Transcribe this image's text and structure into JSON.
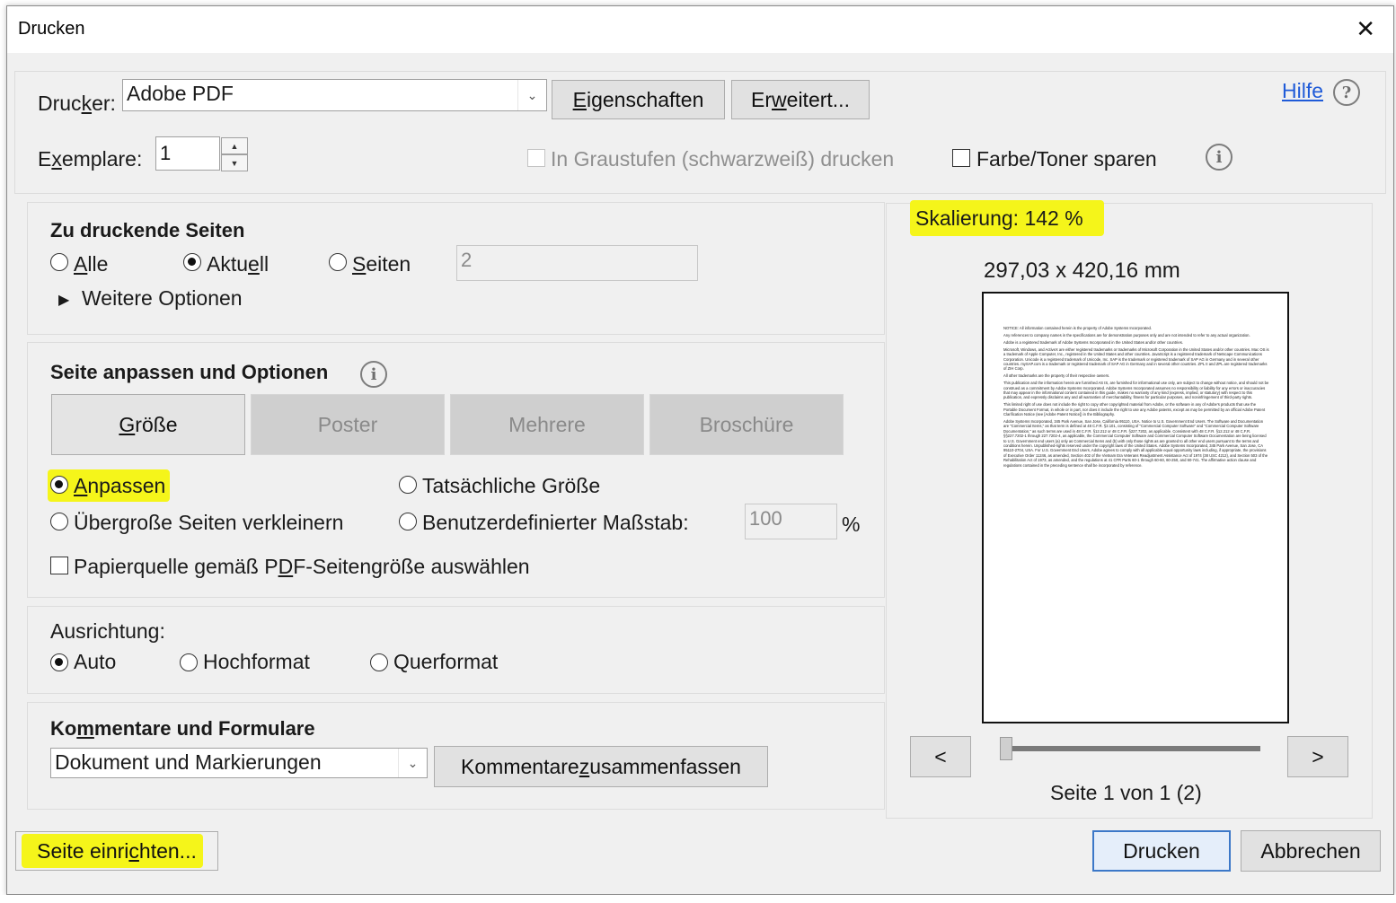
{
  "dialog": {
    "title": "Drucken",
    "close_glyph": "✕"
  },
  "printer": {
    "label": "Drucker:",
    "value": "Adobe PDF",
    "properties_button": "Eigenschaften",
    "advanced_button": "Erweitert...",
    "help_link": "Hilfe",
    "copies_label": "Exemplare:",
    "copies_value": "1",
    "grayscale_label": "In Graustufen (schwarzweiß) drucken",
    "save_toner_label": "Farbe/Toner sparen"
  },
  "pages_to_print": {
    "heading": "Zu druckende Seiten",
    "all_label": "Alle",
    "current_label": "Aktuell",
    "pages_label": "Seiten",
    "pages_value": "2",
    "more_options_label": "Weitere Optionen",
    "selected": "current"
  },
  "page_sizing": {
    "heading": "Seite anpassen und Optionen",
    "tabs": [
      {
        "label": "Größe",
        "active": true
      },
      {
        "label": "Poster",
        "active": false
      },
      {
        "label": "Mehrere",
        "active": false
      },
      {
        "label": "Broschüre",
        "active": false
      }
    ],
    "fit_label": "Anpassen",
    "actual_size_label": "Tatsächliche Größe",
    "shrink_label": "Übergroße Seiten verkleinern",
    "custom_scale_label": "Benutzerdefinierter Maßstab:",
    "custom_scale_value": "100",
    "percent_sign": "%",
    "paper_source_label": "Papierquelle gemäß PDF-Seitengröße auswählen",
    "selected": "fit"
  },
  "orientation": {
    "heading": "Ausrichtung:",
    "auto_label": "Auto",
    "portrait_label": "Hochformat",
    "landscape_label": "Querformat",
    "selected": "auto"
  },
  "comments_forms": {
    "heading": "Kommentare und Formulare",
    "value": "Dokument und Markierungen",
    "summarize_button": "Kommentare zusammenfassen"
  },
  "preview": {
    "scaling_label": "Skalierung: 142 %",
    "dimensions": "297,03 x 420,16 mm",
    "prev_button": "<",
    "next_button": ">",
    "page_status": "Seite 1 von 1 (2)",
    "slider_position": 0,
    "doc_text": [
      "NOTICE: All information contained herein is the property of Adobe Systems Incorporated.",
      "Any references to company names in the specifications are for demonstration purposes only and are not intended to refer to any actual organization.",
      "Adobe is a registered trademark of Adobe Systems Incorporated in the United States and/or other countries.",
      "Microsoft, Windows, and ActiveX are either registered trademarks or trademarks of Microsoft Corporation in the United States and/or other countries. Mac OS is a trademark of Apple Computer, Inc., registered in the United States and other countries. JavaScript is a registered trademark of Netscape Communications Corporation. Unicode is a registered trademark of Unicode, Inc. SAP is the trademark or registered trademark of SAP AG in Germany and in several other countries. mySAP.com is a trademark or registered trademark of SAP AG in Germany and in several other countries. ZPL II and ZPL are registered trademarks of ZIH Corp.",
      "All other trademarks are the property of their respective owners.",
      "This publication and the information herein are furnished AS IS, are furnished for informational use only, are subject to change without notice, and should not be construed as a commitment by Adobe Systems Incorporated. Adobe Systems Incorporated assumes no responsibility or liability for any errors or inaccuracies that may appear in the informational content contained in this guide, makes no warranty of any kind (express, implied, or statutory) with respect to this publication, and expressly disclaims any and all warranties of merchantability, fitness for particular purposes, and noninfringement of third-party rights.",
      "This limited right of use does not include the right to copy other copyrighted material from Adobe, or the software in any of Adobe's products that use the Portable Document Format, in whole or in part, nor does it include the right to use any Adobe patents, except as may be permitted by an official Adobe Patent Clarification Notice (see [Adobe Patent Notice]) in the Bibliography.",
      "Adobe Systems Incorporated, 345 Park Avenue, San Jose, California 95110, USA. Notice to U.S. Government End Users. The Software and Documentation are \"Commercial Items,\" as that term is defined at 48 C.F.R. §2.101, consisting of \"Commercial Computer Software\" and \"Commercial Computer Software Documentation,\" as such terms are used in 48 C.F.R. §12.212 or 48 C.F.R. §227.7202, as applicable. Consistent with 48 C.F.R. §12.212 or 48 C.F.R. §§227.7202-1 through 227.7202-4, as applicable, the Commercial Computer Software and Commercial Computer Software Documentation are being licensed to U.S. Government end users (a) only as Commercial Items and (b) with only those rights as are granted to all other end users pursuant to the terms and conditions herein. Unpublished-rights reserved under the copyright laws of the United States. Adobe Systems Incorporated, 345 Park Avenue, San Jose, CA 95110-2704, USA. For U.S. Government End Users, Adobe agrees to comply with all applicable equal opportunity laws including, if appropriate, the provisions of Executive Order 11246, as amended, Section 402 of the Vietnam Era Veterans Readjustment Assistance Act of 1974 (38 USC 4212), and Section 503 of the Rehabilitation Act of 1973, as amended, and the regulations at 41 CFR Parts 60-1 through 60-60, 60-250, and 60-741. The affirmative action clause and regulations contained in the preceding sentence shall be incorporated by reference."
    ]
  },
  "footer": {
    "page_setup_button": "Seite einrichten...",
    "print_button": "Drucken",
    "cancel_button": "Abbrechen"
  },
  "colors": {
    "highlight": "#f5f51a",
    "link": "#1f5bd8",
    "primary_border": "#3c78c8"
  }
}
